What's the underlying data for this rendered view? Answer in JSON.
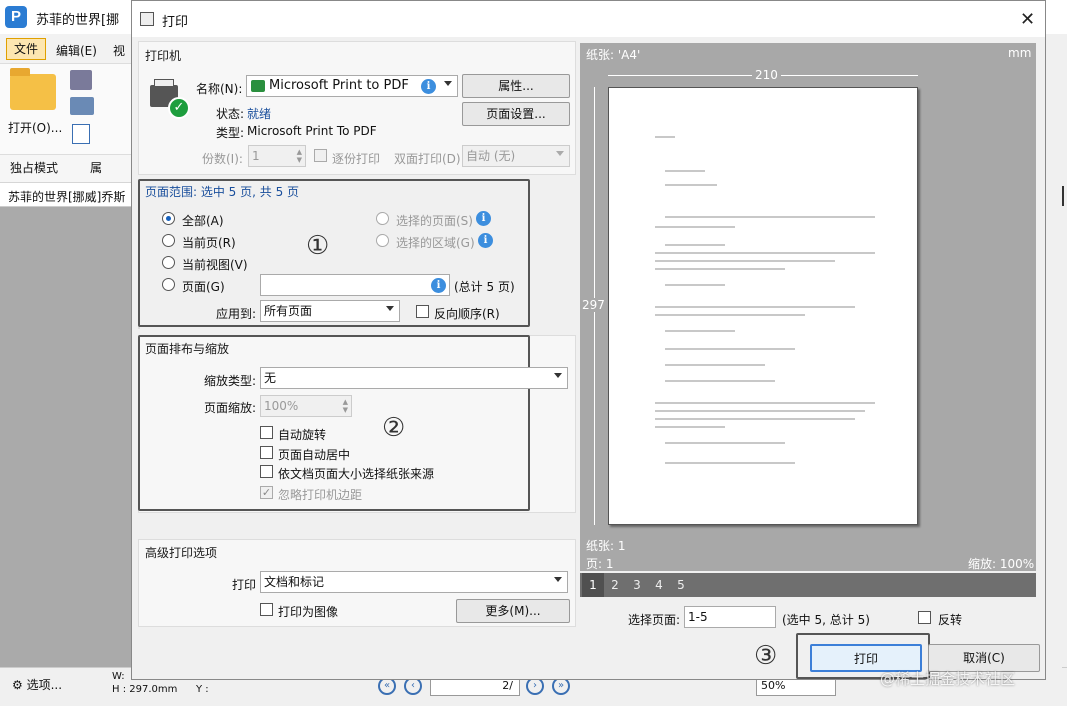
{
  "background_app": {
    "title": "苏菲的世界[挪",
    "menu": {
      "file": "文件",
      "edit": "编辑(E)",
      "view": "视"
    },
    "ribbon": {
      "open_label": "打开(O)...",
      "solo_mode": "独占模式",
      "attr": "属"
    },
    "doc_tab": "苏菲的世界[挪威]乔斯",
    "status": {
      "options": "选项...",
      "w": "W:",
      "h": "H : 297.0mm",
      "y": "Y :",
      "page": "2/",
      "zoom": "50%"
    }
  },
  "dialog": {
    "title": "打印",
    "printer": {
      "section": "打印机",
      "name_label": "名称(N):",
      "name_value": "Microsoft Print to PDF",
      "properties_button": "属性...",
      "page_setup_button": "页面设置...",
      "status_label": "状态:",
      "status_value": "就绪",
      "type_label": "类型:",
      "type_value": "Microsoft Print To PDF",
      "copies_label": "份数(I):",
      "copies_value": "1",
      "collate_label": "逐份打印",
      "duplex_label": "双面打印(D)",
      "duplex_value": "自动 (无)"
    },
    "range": {
      "section": "页面范围: 选中 5 页, 共 5 页",
      "all": "全部(A)",
      "current_page": "当前页(R)",
      "current_view": "当前视图(V)",
      "pages": "页面(G)",
      "selected_pages": "选择的页面(S)",
      "selected_area": "选择的区域(G)",
      "total": "(总计 5 页)",
      "apply_label": "应用到:",
      "apply_value": "所有页面",
      "reverse": "反向顺序(R)",
      "annotation": "①"
    },
    "layout": {
      "section": "页面排布与缩放",
      "scale_type_label": "缩放类型:",
      "scale_type_value": "无",
      "page_scale_label": "页面缩放:",
      "page_scale_value": "100%",
      "auto_rotate": "自动旋转",
      "auto_center": "页面自动居中",
      "paper_source": "依文档页面大小选择纸张来源",
      "ignore_margin": "忽略打印机边距",
      "annotation": "②"
    },
    "advanced": {
      "section": "高级打印选项",
      "print_label": "打印",
      "print_value": "文档和标记",
      "print_as_image": "打印为图像",
      "more_button": "更多(M)..."
    },
    "preview": {
      "paper": "纸张: 'A4'",
      "unit": "mm",
      "width": "210",
      "height": "297",
      "paper_count": "纸张: 1",
      "page_count": "页: 1",
      "zoom": "缩放: 100%",
      "tabs": [
        "1",
        "2",
        "3",
        "4",
        "5"
      ],
      "select_pages_label": "选择页面:",
      "select_pages_value": "1-5",
      "select_pages_info": "(选中 5, 总计 5)",
      "flip_label": "反转"
    },
    "footer": {
      "annotation": "③",
      "print_button": "打印",
      "cancel_button": "取消(C)"
    }
  },
  "watermark": "@稀土掘金技术社区"
}
